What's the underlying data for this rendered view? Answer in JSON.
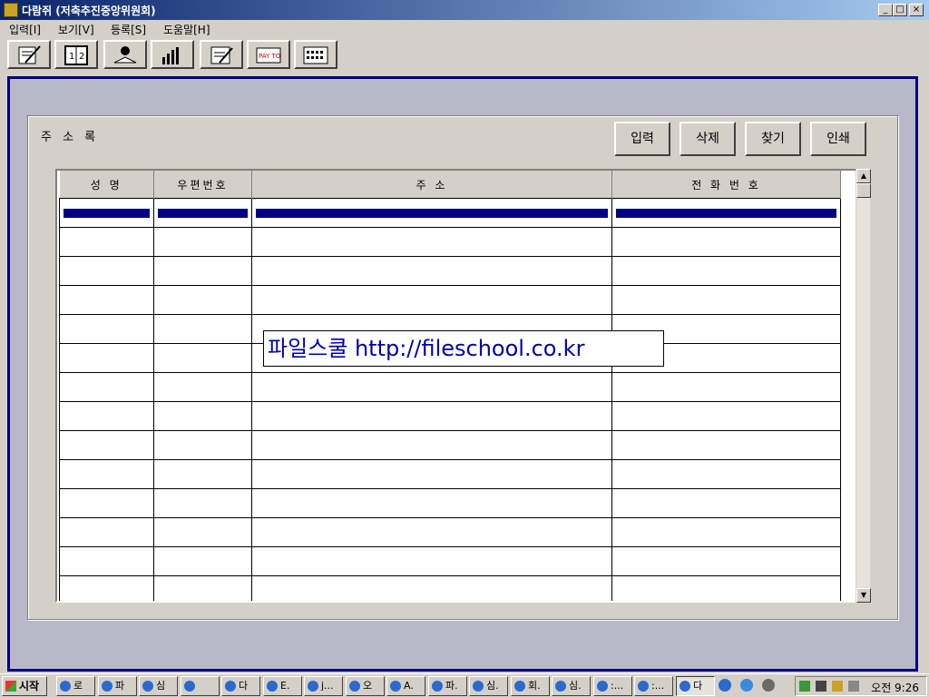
{
  "window": {
    "title": "다람쥐 (저축추진중앙위원회)",
    "min_symbol": "_",
    "max_symbol": "□",
    "close_symbol": "×"
  },
  "menu": [
    "입력[I]",
    "보기[V]",
    "등록[S]",
    "도움말[H]"
  ],
  "toolbar_icons": [
    "notepad-pencil-icon",
    "book-numbers-icon",
    "reader-book-icon",
    "bar-chart-icon",
    "memo-edit-icon",
    "pay-to-check-icon",
    "calculator-icon"
  ],
  "toolbar_pay_label": "PAY TO",
  "panel": {
    "title": "주 소 록",
    "buttons": [
      "입력",
      "삭제",
      "찾기",
      "인쇄"
    ]
  },
  "grid": {
    "columns": [
      "성 명",
      "우편번호",
      "주 소",
      "전 화 번 호"
    ],
    "empty_rows": 13
  },
  "watermark": "파일스쿨 http://fileschool.co.kr",
  "taskbar": {
    "start": "시작",
    "tasks": [
      "로",
      "파",
      "심",
      "",
      "다",
      "E.",
      "j...",
      "오",
      "A.",
      "파.",
      "심.",
      "회.",
      "심.",
      ":...",
      ":...",
      "다"
    ],
    "clock": "오전 9:26"
  },
  "colors": {
    "mdi_border": "#000080",
    "selection": "#000080",
    "watermark_text": "#0000aa"
  }
}
